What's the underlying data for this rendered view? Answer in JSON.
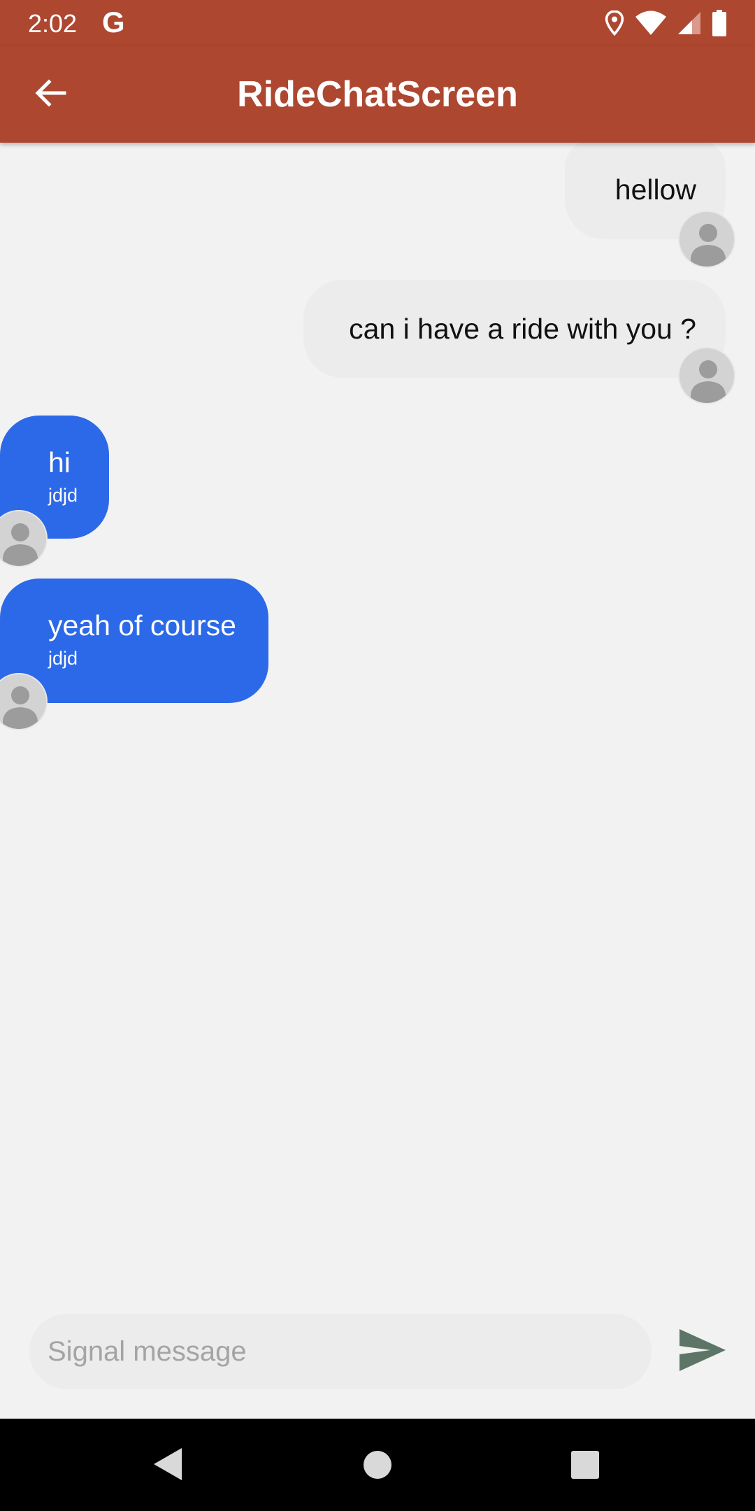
{
  "status_bar": {
    "time": "2:02",
    "g_logo": "G",
    "icons": [
      "location-icon",
      "wifi-icon",
      "signal-icon",
      "battery-icon"
    ]
  },
  "app_bar": {
    "title": "RideChatScreen",
    "back_icon": "arrow-left-icon"
  },
  "messages": [
    {
      "direction": "outgoing",
      "text": "hellow"
    },
    {
      "direction": "outgoing",
      "text": "can i have a ride with you ?"
    },
    {
      "direction": "incoming",
      "text": "hi",
      "sender": "jdjd"
    },
    {
      "direction": "incoming",
      "text": "yeah of course",
      "sender": "jdjd"
    }
  ],
  "composer": {
    "placeholder": "Signal message",
    "value": "",
    "send_icon": "send-icon"
  },
  "colors": {
    "app_bar": "#ad4730",
    "incoming_bubble": "#2c69e8",
    "outgoing_bubble": "#ececec",
    "send_icon": "#5c7566",
    "background": "#f2f2f2"
  },
  "nav_bar": {
    "icons": [
      "back-triangle-icon",
      "home-circle-icon",
      "recents-square-icon"
    ]
  }
}
